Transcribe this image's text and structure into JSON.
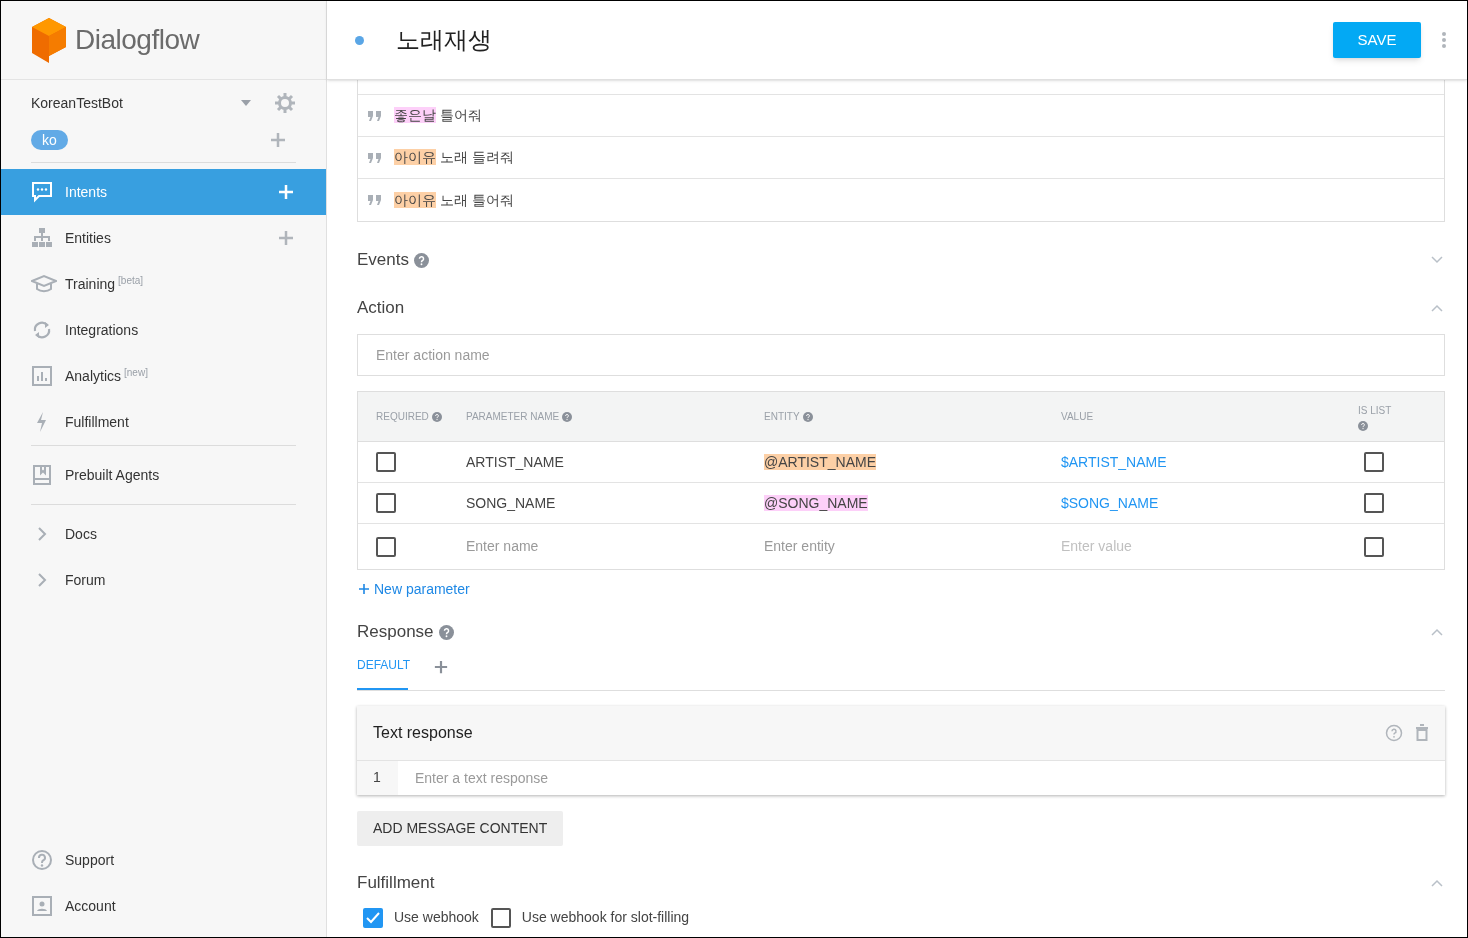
{
  "sidebar": {
    "brand": "Dialogflow",
    "agent": {
      "name": "KoreanTestBot",
      "language": "ko"
    },
    "sections": [
      [
        {
          "label": "Intents",
          "selected": true,
          "add": true
        },
        {
          "label": "Entities",
          "selected": false,
          "add": true
        },
        {
          "label": "Training",
          "selected": false,
          "add": false,
          "tag": "[beta]"
        },
        {
          "label": "Integrations",
          "selected": false,
          "add": false
        },
        {
          "label": "Analytics",
          "selected": false,
          "add": false,
          "tag": "[new]"
        },
        {
          "label": "Fulfillment",
          "selected": false,
          "add": false
        }
      ],
      [
        {
          "label": "Prebuilt Agents",
          "selected": false,
          "add": false
        }
      ],
      [
        {
          "label": "Docs",
          "selected": false,
          "add": false
        },
        {
          "label": "Forum",
          "selected": false,
          "add": false
        }
      ]
    ],
    "bottom": [
      {
        "label": "Support",
        "selected": false
      },
      {
        "label": "Account",
        "selected": false
      }
    ]
  },
  "header": {
    "title": "노래재생",
    "save": "SAVE"
  },
  "training_phrases": [
    [
      {
        "text": "좋은날",
        "color": "#fdd0f9"
      },
      {
        "text": " 틀어줘"
      }
    ],
    [
      {
        "text": "아이유",
        "color": "#fdd0a6"
      },
      {
        "text": " 노래 들려줘"
      }
    ],
    [
      {
        "text": "아이유",
        "color": "#fdd0a6"
      },
      {
        "text": " 노래 틀어줘"
      }
    ]
  ],
  "events": {
    "title": "Events",
    "expanded": false
  },
  "action": {
    "title": "Action",
    "expanded": true,
    "placeholder": "Enter action name"
  },
  "parameters": {
    "columns": [
      "REQUIRED",
      "PARAMETER NAME",
      "ENTITY",
      "VALUE",
      "IS LIST"
    ],
    "rows": [
      {
        "required": false,
        "name": "ARTIST_NAME",
        "entity": "@ARTIST_NAME",
        "color": "#fdd0a6",
        "value": "$ARTIST_NAME",
        "is_list": false
      },
      {
        "required": false,
        "name": "SONG_NAME",
        "entity": "@SONG_NAME",
        "color": "#fdd0f9",
        "value": "$SONG_NAME",
        "is_list": false
      }
    ],
    "new_row": {
      "required": false,
      "name_placeholder": "Enter name",
      "entity_placeholder": "Enter entity",
      "value_placeholder": "Enter value",
      "is_list": false
    },
    "add_link": "New parameter"
  },
  "response": {
    "title": "Response",
    "expanded": true,
    "tabs": [
      {
        "label": "DEFAULT",
        "selected": true
      }
    ],
    "card": {
      "title": "Text response",
      "line": "1",
      "placeholder": "Enter a text response"
    },
    "add_button": "ADD MESSAGE CONTENT"
  },
  "fulfillment": {
    "title": "Fulfillment",
    "expanded": true,
    "options": [
      {
        "label": "Use webhook",
        "checked": true
      },
      {
        "label": "Use webhook for slot-filling",
        "checked": false
      }
    ]
  }
}
